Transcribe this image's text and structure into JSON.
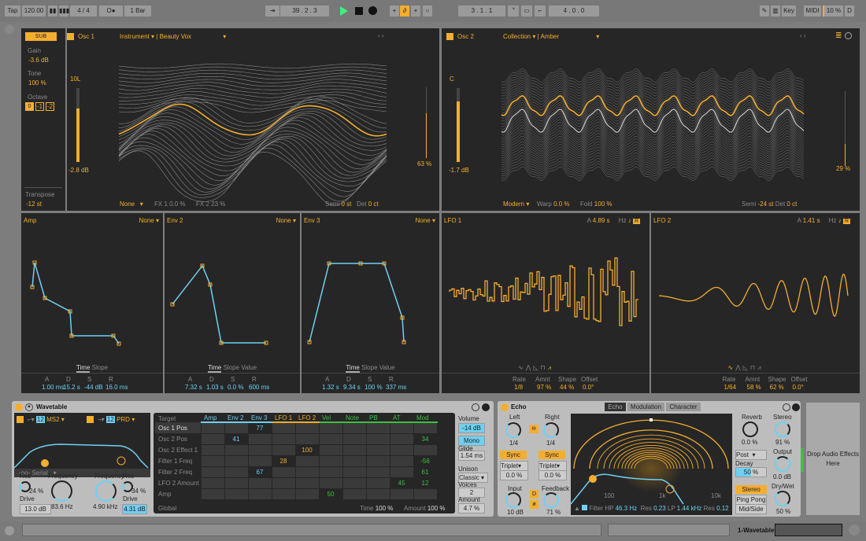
{
  "transport": {
    "tap": "Tap",
    "tempo": "120.00",
    "signature": "4 / 4",
    "metronome": "O●",
    "quantize": "1 Bar",
    "position": "39 . 2 . 3",
    "loop_start": "3 . 1 . 1",
    "loop_length": "4 . 0 . 0",
    "key": "Key",
    "midi": "MIDI",
    "cpu": "10 %",
    "d": "D"
  },
  "sub": {
    "button": "SUB",
    "gain_label": "Gain",
    "gain": "-3.6 dB",
    "tone_label": "Tone",
    "tone": "100 %",
    "octave_label": "Octave",
    "octaves": [
      "0",
      "-1",
      "-2"
    ],
    "octave_selected": "0",
    "transpose_label": "Transpose",
    "transpose": "-12 st"
  },
  "osc1": {
    "title": "Osc 1",
    "category": "Instrument",
    "wavetable": "Beauty Vox",
    "pan": "10L",
    "gain": "-2.8 dB",
    "position": "63 %",
    "position_value": 0.63,
    "gain_level": 0.72,
    "fx_mode": "None",
    "fx1": "FX 1 0.0 %",
    "fx2": "FX 2 23 %",
    "semi_label": "Semi",
    "semi": "0 st",
    "det_label": "Det",
    "det": "0 ct"
  },
  "osc2": {
    "title": "Osc 2",
    "category": "Collection",
    "wavetable": "Amber",
    "pan": "C",
    "gain": "-1.7 dB",
    "position": "29 %",
    "position_value": 0.29,
    "gain_level": 0.82,
    "fx_mode": "Modern",
    "warp_label": "Warp",
    "warp": "0.0 %",
    "fold_label": "Fold",
    "fold": "100 %",
    "semi_label": "Semi",
    "semi": "-24 st",
    "det_label": "Det",
    "det": "0 ct"
  },
  "envelopes": [
    {
      "title": "Amp",
      "target": "None",
      "tabs": [
        "Time",
        "Slope"
      ],
      "labels": [
        "A",
        "D",
        "S",
        "R"
      ],
      "values": [
        "1.00 ms",
        "15.2 s",
        "-44 dB",
        "16.0 ms"
      ]
    },
    {
      "title": "Env 2",
      "target": "None",
      "tabs": [
        "Time",
        "Slope",
        "Value"
      ],
      "labels": [
        "A",
        "D",
        "S",
        "R"
      ],
      "values": [
        "7.32 s",
        "1.03 s",
        "0.0 %",
        "600 ms"
      ]
    },
    {
      "title": "Env 3",
      "target": "None",
      "tabs": [
        "Time",
        "Slope",
        "Value"
      ],
      "labels": [
        "A",
        "D",
        "S",
        "R"
      ],
      "values": [
        "1.32 s",
        "9.34 s",
        "100 %",
        "337 ms"
      ]
    }
  ],
  "lfos": [
    {
      "title": "LFO 1",
      "a_label": "A",
      "a": "4.89 s",
      "hz": "Hz",
      "labels": [
        "Rate",
        "Amnt",
        "Shape",
        "Offset"
      ],
      "values": [
        "1/8",
        "97 %",
        "44 %",
        "0.0°"
      ],
      "waveform": "random"
    },
    {
      "title": "LFO 2",
      "a_label": "A",
      "a": "1.41 s",
      "hz": "Hz",
      "labels": [
        "Rate",
        "Amnt",
        "Shape",
        "Offset"
      ],
      "values": [
        "1/64",
        "58 %",
        "62 %",
        "0.0°"
      ],
      "waveform": "sine"
    }
  ],
  "wavetable": {
    "title": "Wavetable",
    "filter1": {
      "slope": "12",
      "type": "MS2",
      "res_label": "Res",
      "res": "24 %",
      "freq_label": "Frequency",
      "freq": "83.6 Hz",
      "drive_label": "Drive",
      "drive": "13.0 dB"
    },
    "filter2": {
      "slope": "12",
      "type": "PRD",
      "freq_label": "Frequency",
      "freq": "4.90 kHz",
      "res_label": "Res",
      "res": "34 %",
      "drive_label": "Drive",
      "drive": "4.31 dB"
    },
    "routing": "Serial",
    "matrix": {
      "target_label": "Target",
      "columns": [
        "Amp",
        "Env 2",
        "Env 3",
        "LFO 1",
        "LFO 2",
        "Vel",
        "Note",
        "PB",
        "AT",
        "Mod"
      ],
      "rows": [
        {
          "name": "Osc 1 Pos",
          "cells": [
            null,
            null,
            "77",
            null,
            null,
            null,
            null,
            null,
            null,
            null
          ]
        },
        {
          "name": "Osc 2 Pos",
          "cells": [
            null,
            "41",
            null,
            null,
            null,
            null,
            null,
            null,
            null,
            "34"
          ]
        },
        {
          "name": "Osc 2 Effect 1",
          "cells": [
            null,
            null,
            null,
            null,
            "100",
            null,
            null,
            null,
            null,
            null
          ]
        },
        {
          "name": "Filter 1 Freq",
          "cells": [
            null,
            null,
            null,
            "28",
            null,
            null,
            null,
            null,
            null,
            "-56"
          ]
        },
        {
          "name": "Filter 2 Freq",
          "cells": [
            null,
            null,
            "67",
            null,
            null,
            null,
            null,
            null,
            null,
            "61"
          ]
        },
        {
          "name": "LFO 2 Amount",
          "cells": [
            null,
            null,
            null,
            null,
            null,
            null,
            null,
            null,
            "45",
            "12"
          ]
        },
        {
          "name": "Amp",
          "cells": [
            null,
            null,
            null,
            null,
            null,
            "50",
            null,
            null,
            null,
            null
          ]
        }
      ],
      "global_label": "Global",
      "time_label": "Time",
      "time": "100 %",
      "amount_label": "Amount",
      "amount": "100 %"
    },
    "volume_label": "Volume",
    "volume": "-14 dB",
    "mono": "Mono",
    "glide_label": "Glide",
    "glide": "1.54 ms",
    "unison_label": "Unison",
    "unison": "Classic",
    "voices_label": "Voices",
    "voices": "2",
    "amount_label": "Amount",
    "amount": "4.7 %"
  },
  "echo": {
    "title": "Echo",
    "tabs": [
      "Echo",
      "Modulation",
      "Character"
    ],
    "left_label": "Left",
    "left": "1/4",
    "right_label": "Right",
    "right": "1/4",
    "sync": "Sync",
    "triplet": "Triplet",
    "left_offset": "0.0 %",
    "right_offset": "0.0 %",
    "input_label": "Input",
    "input": "10 dB",
    "d": "D",
    "feedback_label": "Feedback",
    "feedback": "71 %",
    "freq_ticks": [
      "100",
      "1k",
      "10k"
    ],
    "filter_label": "Filter",
    "hp_label": "HP",
    "hp": "46.3 Hz",
    "res_label": "Res",
    "hp_res": "0.23",
    "lp_label": "LP",
    "lp": "1.44 kHz",
    "lp_res": "0.12",
    "reverb_label": "Reverb",
    "reverb": "0.0 %",
    "stereo_label": "Stereo",
    "stereo": "91 %",
    "reverb_pos": "Post",
    "decay_label": "Decay",
    "decay": "50 %",
    "output_label": "Output",
    "output": "0.0 dB",
    "modes": [
      "Stereo",
      "Ping Pong",
      "Mid/Side"
    ],
    "drywet_label": "Dry/Wet",
    "drywet": "50 %"
  },
  "drop": "Drop Audio Effects Here",
  "track_name": "1-Wavetable",
  "colors": {
    "accent": "#f4ae2f",
    "blue": "#6fd0f2",
    "green": "#3ec03e",
    "panel": "#262626"
  }
}
